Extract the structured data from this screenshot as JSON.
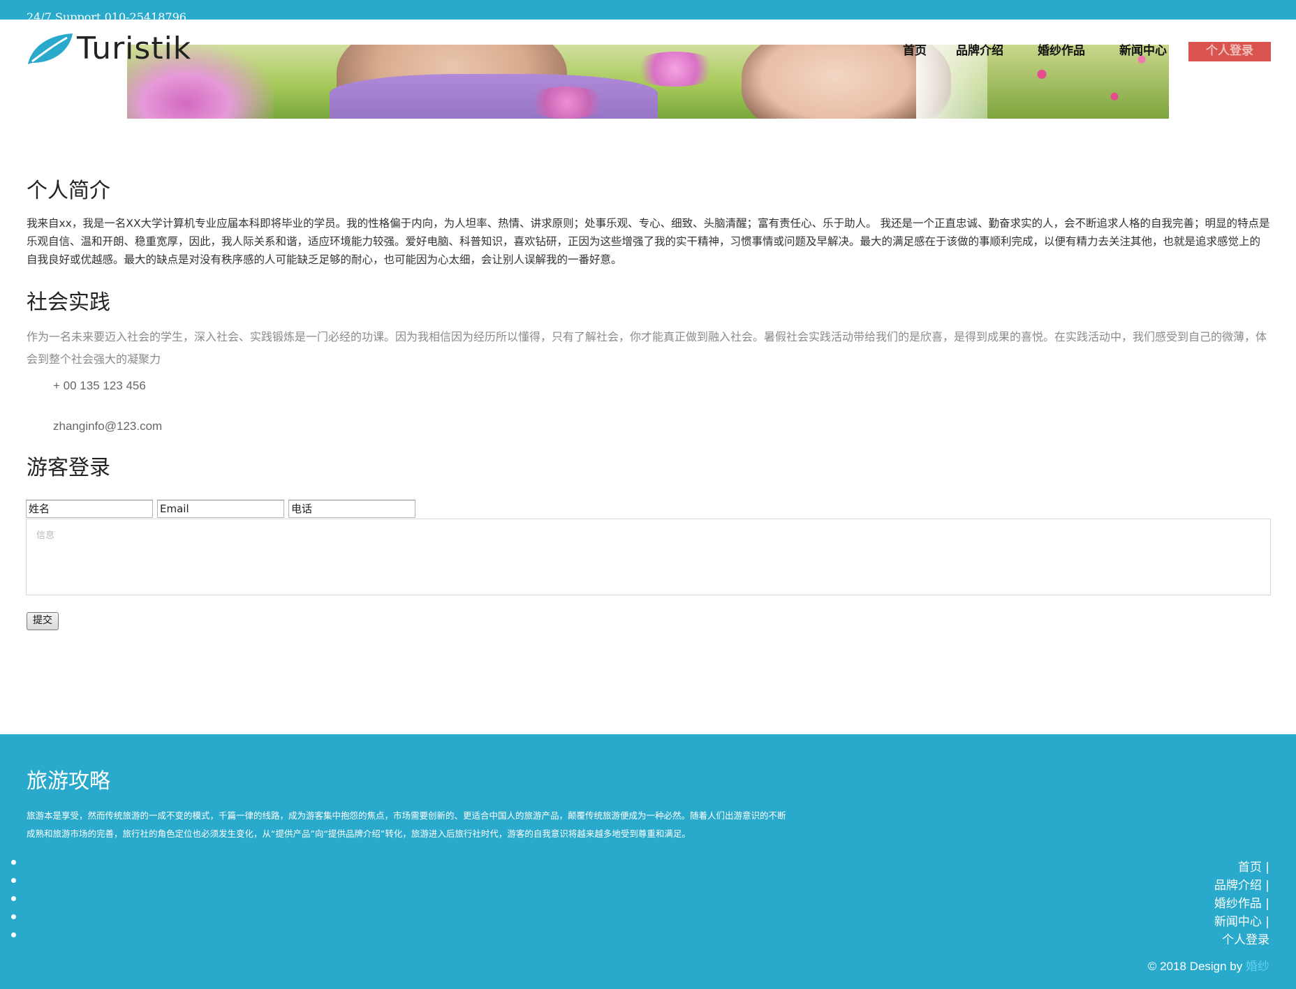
{
  "header": {
    "support_text": "24/7 Support 010-25418796",
    "brand": "Turistik",
    "nav": [
      {
        "label": "首页"
      },
      {
        "label": "品牌介绍"
      },
      {
        "label": "婚纱作品"
      },
      {
        "label": "新闻中心"
      },
      {
        "label": "个人登录"
      }
    ]
  },
  "about": {
    "title": "个人简介",
    "text": "我来自xx，我是一名XX大学计算机专业应届本科即将毕业的学员。我的性格偏于内向，为人坦率、热情、讲求原则；处事乐观、专心、细致、头脑清醒；富有责任心、乐于助人。 我还是一个正直忠诚、勤奋求实的人，会不断追求人格的自我完善；明显的特点是乐观自信、温和开朗、稳重宽厚，因此，我人际关系和谐，适应环境能力较强。爱好电脑、科普知识，喜欢钻研，正因为这些增强了我的实干精神，习惯事情或问题及早解决。最大的满足感在于该做的事顺利完成，以便有精力去关注其他，也就是追求感觉上的自我良好或优越感。最大的缺点是对没有秩序感的人可能缺乏足够的耐心，也可能因为心太细，会让别人误解我的一番好意。"
  },
  "practice": {
    "title": "社会实践",
    "text": "作为一名未来要迈入社会的学生，深入社会、实践锻炼是一门必经的功课。因为我相信因为经历所以懂得，只有了解社会，你才能真正做到融入社会。暑假社会实践活动带给我们的是欣喜，是得到成果的喜悦。在实践活动中，我们感受到自己的微薄，体会到整个社会强大的凝聚力",
    "phone": "+ 00 135 123 456",
    "email": "zhanginfo@123.com"
  },
  "guest_login": {
    "title": "游客登录",
    "name_value": "姓名",
    "email_value": "Email",
    "phone_value": "电话",
    "message_placeholder": "信息",
    "submit_label": "提交"
  },
  "footer": {
    "title": "旅游攻略",
    "text": "旅游本是享受，然而传统旅游的一成不变的模式，千篇一律的线路，成为游客集中抱怨的焦点，市场需要创新的、更适合中国人的旅游产品，颠覆传统旅游便成为一种必然。随着人们出游意识的不断成熟和旅游市场的完善，旅行社的角色定位也必须发生变化，从“提供产品”向“提供品牌介绍”转化，旅游进入后旅行社时代，游客的自我意识将越来越多地受到尊重和满足。",
    "links": [
      "首页 |",
      "品牌介绍 |",
      "婚纱作品 |",
      "新闻中心 |",
      "个人登录"
    ],
    "copyright": "© 2018 Design by",
    "copyright_link": "婚纱"
  },
  "colors": {
    "accent": "#29a9cb",
    "login_button": "#d9534f"
  }
}
